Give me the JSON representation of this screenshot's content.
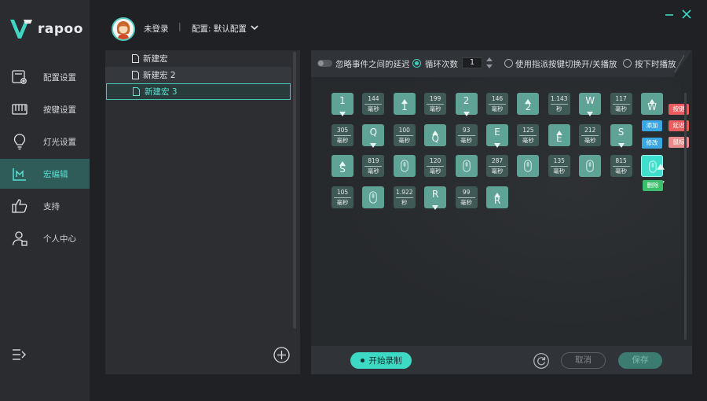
{
  "app": {
    "brand": "rapoo"
  },
  "sidebar": {
    "items": [
      {
        "label": "配置设置",
        "icon": "config-settings-icon"
      },
      {
        "label": "按键设置",
        "icon": "key-settings-icon"
      },
      {
        "label": "灯光设置",
        "icon": "light-bulb-icon"
      },
      {
        "label": "宏编辑",
        "icon": "macro-edit-icon",
        "active": true
      },
      {
        "label": "支持",
        "icon": "thumbs-up-icon"
      },
      {
        "label": "个人中心",
        "icon": "user-center-icon"
      }
    ]
  },
  "header": {
    "login_status": "未登录",
    "separator": "|",
    "profile_label": "配置: 默认配置"
  },
  "macros": {
    "items": [
      {
        "label": "新建宏"
      },
      {
        "label": "新建宏 2"
      },
      {
        "label": "新建宏 3",
        "selected": true
      }
    ]
  },
  "options": {
    "ignore_delay": "忽略事件之间的延迟",
    "loop_count_label": "循环次数",
    "loop_count_value": "1",
    "toggle_key": "使用指派按键切换开/关播放",
    "hold_play": "按下时播放"
  },
  "events": {
    "unit_ms": "毫秒",
    "unit_s": "秒",
    "row1": [
      {
        "type": "key",
        "key": "1",
        "dir": "down"
      },
      {
        "type": "delay",
        "value": "144",
        "unit": "毫秒"
      },
      {
        "type": "key",
        "key": "1",
        "dir": "up"
      },
      {
        "type": "delay",
        "value": "199",
        "unit": "毫秒"
      },
      {
        "type": "key",
        "key": "2",
        "dir": "down"
      },
      {
        "type": "delay",
        "value": "146",
        "unit": "毫秒"
      },
      {
        "type": "key",
        "key": "2",
        "dir": "up"
      },
      {
        "type": "delay",
        "value": "1.143",
        "unit": "秒"
      },
      {
        "type": "key",
        "key": "W",
        "dir": "down"
      },
      {
        "type": "delay",
        "value": "117",
        "unit": "毫秒"
      },
      {
        "type": "key",
        "key": "W",
        "dir": "up"
      }
    ],
    "row2": [
      {
        "type": "delay",
        "value": "305",
        "unit": "毫秒"
      },
      {
        "type": "key",
        "key": "Q",
        "dir": "down"
      },
      {
        "type": "delay",
        "value": "100",
        "unit": "毫秒"
      },
      {
        "type": "key",
        "key": "Q",
        "dir": "up"
      },
      {
        "type": "delay",
        "value": "93",
        "unit": "毫秒"
      },
      {
        "type": "key",
        "key": "E",
        "dir": "down"
      },
      {
        "type": "delay",
        "value": "125",
        "unit": "毫秒"
      },
      {
        "type": "key",
        "key": "E",
        "dir": "up"
      },
      {
        "type": "delay",
        "value": "212",
        "unit": "毫秒"
      },
      {
        "type": "key",
        "key": "S",
        "dir": "down"
      }
    ],
    "row3": [
      {
        "type": "key",
        "key": "S",
        "dir": "up"
      },
      {
        "type": "delay",
        "value": "819",
        "unit": "毫秒"
      },
      {
        "type": "mouse"
      },
      {
        "type": "delay",
        "value": "120",
        "unit": "毫秒"
      },
      {
        "type": "mouse"
      },
      {
        "type": "delay",
        "value": "287",
        "unit": "毫秒"
      },
      {
        "type": "mouse"
      },
      {
        "type": "delay",
        "value": "135",
        "unit": "毫秒"
      },
      {
        "type": "mouse"
      },
      {
        "type": "delay",
        "value": "815",
        "unit": "毫秒"
      },
      {
        "type": "mouse",
        "selected": true
      }
    ],
    "row4": [
      {
        "type": "delay",
        "value": "105",
        "unit": "毫秒"
      },
      {
        "type": "mouse"
      },
      {
        "type": "delay",
        "value": "1.922",
        "unit": "秒"
      },
      {
        "type": "key",
        "key": "R",
        "dir": "down"
      },
      {
        "type": "delay",
        "value": "99",
        "unit": "毫秒"
      },
      {
        "type": "key",
        "key": "R",
        "dir": "up"
      }
    ]
  },
  "edit_actions": {
    "add": "添加",
    "modify": "修改",
    "delete": "删除",
    "key": "按键",
    "delay": "延迟",
    "mouse": "鼠标"
  },
  "footer": {
    "record": "开始录制",
    "cancel": "取消",
    "save": "保存"
  },
  "colors": {
    "accent": "#3ed9c4",
    "key_tile": "#5fa396",
    "delay_tile": "#3f5a56",
    "tag_blue": "#3aa7e0",
    "tag_red": "#e85d5d",
    "tag_green": "#3ac06b"
  }
}
